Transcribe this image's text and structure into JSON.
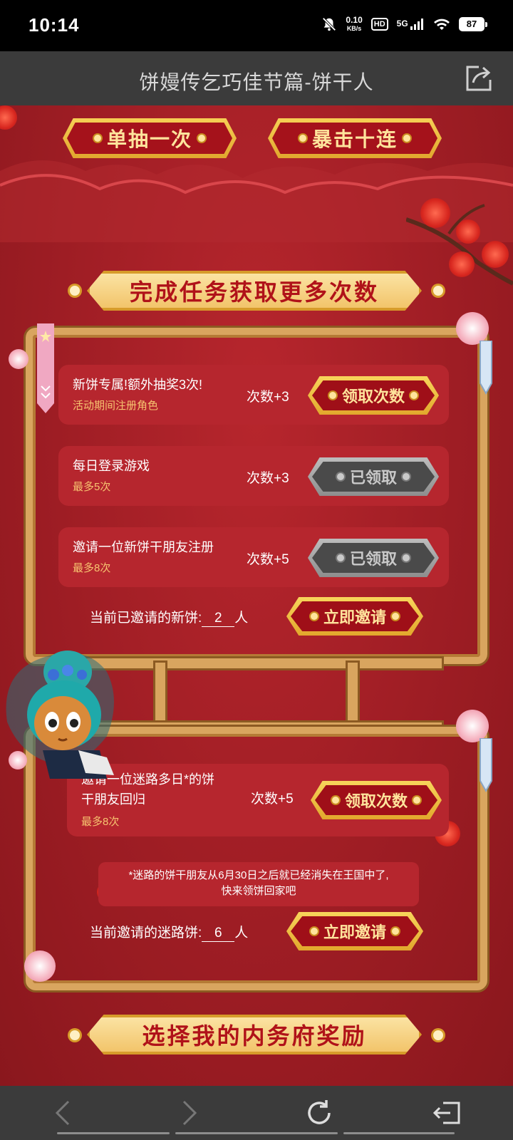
{
  "status_bar": {
    "time": "10:14",
    "net_speed_value": "0.10",
    "net_speed_unit": "KB/s",
    "hd": "HD",
    "signal": "5G",
    "battery": "87"
  },
  "header": {
    "title": "饼嫚传乞巧佳节篇-饼干人"
  },
  "draw_buttons": {
    "single": "单抽一次",
    "ten": "暴击十连"
  },
  "section_tasks": {
    "title": "完成任务获取更多次数"
  },
  "tasks": [
    {
      "title": "新饼专属!额外抽奖3次!",
      "subtitle": "活动期间注册角色",
      "count": "次数+3",
      "button": "领取次数",
      "state": "active"
    },
    {
      "title": "每日登录游戏",
      "subtitle": "最多5次",
      "count": "次数+3",
      "button": "已领取",
      "state": "done"
    },
    {
      "title": "邀请一位新饼干朋友注册",
      "subtitle": "最多8次",
      "count": "次数+5",
      "button": "已领取",
      "state": "done"
    }
  ],
  "invite_new": {
    "prefix": "当前已邀请的新饼:",
    "number": "2",
    "suffix": "人",
    "button": "立即邀请"
  },
  "returning_task": {
    "title_line1": "邀请一位迷路多日*的饼",
    "title_line2": "干朋友回归",
    "subtitle": "最多8次",
    "count": "次数+5",
    "button": "领取次数"
  },
  "note": {
    "line1": "*迷路的饼干朋友从6月30日之后就已经消失在王国中了,",
    "line2": "快来领饼回家吧"
  },
  "invite_lost": {
    "prefix": "当前邀请的迷路饼:",
    "number": "6",
    "suffix": "人",
    "button": "立即邀请"
  },
  "section_reward": {
    "title": "选择我的内务府奖励"
  },
  "colors": {
    "bg_red": "#9e1d24",
    "gold": "#f3c541",
    "dark_bar": "#3b3b3b"
  }
}
